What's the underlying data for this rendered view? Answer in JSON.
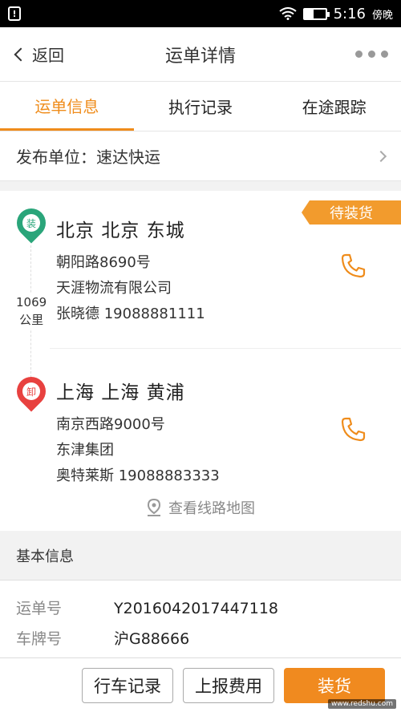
{
  "status_bar": {
    "time": "5:16",
    "carrier": "傍晚",
    "alert_icon": "alert-icon"
  },
  "nav": {
    "back_label": "返回",
    "title": "运单详情"
  },
  "tabs": [
    {
      "label": "运单信息",
      "active": true
    },
    {
      "label": "执行记录",
      "active": false
    },
    {
      "label": "在途跟踪",
      "active": false
    }
  ],
  "publisher": {
    "label": "发布单位：速达快运"
  },
  "route": {
    "status": "待装货",
    "distance_value": "1069",
    "distance_unit": "公里",
    "origin": {
      "badge": "装",
      "city": "北京  北京  东城",
      "address": "朝阳路8690号",
      "company": "天涯物流有限公司",
      "contact": "张晓德  19088881111"
    },
    "destination": {
      "badge": "卸",
      "city": "上海  上海  黄浦",
      "address": "南京西路9000号",
      "company": "东津集团",
      "contact": "奥特莱斯  19088883333"
    },
    "map_link": "查看线路地图"
  },
  "basic_info": {
    "heading": "基本信息",
    "rows": [
      {
        "key": "运单号",
        "value": "Y2016042017447118"
      },
      {
        "key": "车牌号",
        "value": "沪G88666"
      }
    ]
  },
  "actions": {
    "drive_record": "行车记录",
    "report_fee": "上报费用",
    "primary": "装货"
  },
  "watermark": "www.redshu.com",
  "colors": {
    "accent": "#ef8c1b",
    "load_green": "#2aa57a",
    "unload_red": "#e8413f"
  }
}
